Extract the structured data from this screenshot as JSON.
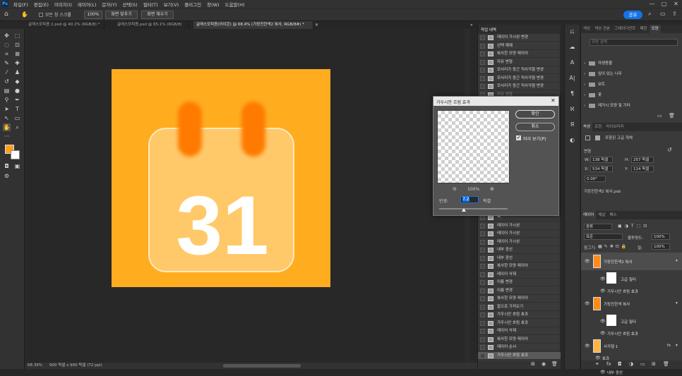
{
  "app": {
    "logo": "Ps"
  },
  "menu": [
    "파일(F)",
    "편집(E)",
    "이미지(I)",
    "레이어(L)",
    "문자(Y)",
    "선택(S)",
    "필터(T)",
    "보기(V)",
    "플러그인",
    "창(W)",
    "도움말(H)"
  ],
  "window_controls": {
    "minimize": "—",
    "maximize": "▢",
    "close": "✕"
  },
  "options": {
    "scroll_all": "모든 창 스크롤",
    "zoom": "100%",
    "fit_screen": "화면 맞추기",
    "fill_screen": "화면 채우기",
    "share": "공유"
  },
  "doc_tabs": [
    {
      "label": "글래스모피즘 2.psd @ 40.2% (RGB/8) *",
      "active": false
    },
    {
      "label": "글래스모피즘.psd @ 65.1% (RGB/8)",
      "active": false
    },
    {
      "label": "글래스모피즘(아이콘) @ 68.4% (가장진한색2 복사, RGB/8#) *",
      "active": true
    }
  ],
  "canvas": {
    "calendar_number": "31",
    "bg_color": "#ffad1f",
    "ring_color": "#ff7a00"
  },
  "status": {
    "zoom": "68.39%",
    "doc_info": "900 픽셀 x 900 픽셀 (72 ppi)"
  },
  "history": {
    "title": "작업 내역",
    "items_top": [
      "레이어 가시성 변경",
      "선택 해제",
      "복사한 모양 레이어",
      "자유 변형",
      "모서리가 둥근 직사각형 변경",
      "모서리가 둥근 직사각형 변경",
      "모서리가 둥근 직사각형 변경",
      "자유 변형"
    ],
    "items_bottom": [
      "픽",
      "레이어 가시성",
      "레이어 가시성",
      "레이어 가시성",
      "내부 광선",
      "내부 광선",
      "복사한 모양 레이어",
      "레이어 삭제",
      "이름 변경",
      "이름 변경",
      "복사한 모양 레이어",
      "알으로 가져오기",
      "가우시안 흐림 효과",
      "가우시안 흐림 효과",
      "레이어 삭제",
      "복사한 모양 레이어",
      "레이어 순서",
      "가우시안 흐림 효과"
    ]
  },
  "dialog": {
    "title": "가우시안 흐림 효과",
    "ok": "확인",
    "cancel": "취소",
    "preview": "미리 보기(P)",
    "zoom": "100%",
    "radius_label": "반경:",
    "radius_value": "7.2",
    "radius_unit": "픽셀",
    "radius_fraction": 0.36
  },
  "shapes_panel": {
    "tabs": [
      "색상",
      "색상 견본",
      "그레이디언트",
      "패턴",
      "모양"
    ],
    "search": "모양 검색",
    "items": [
      "야생동물",
      "잎이 있는 나무",
      "보트",
      "꽃",
      "레거시 모양 및 기타"
    ]
  },
  "properties": {
    "tabs": [
      "속성",
      "조정",
      "라이브러리"
    ],
    "type": "고급 개체",
    "kind": "포함된 고급 개체",
    "transform": "변형",
    "w": "W:",
    "w_val": "138 픽셀",
    "h": "H:",
    "h_val": "257 픽셀",
    "x": "X:",
    "x_val": "534 픽셀",
    "y": "Y:",
    "y_val": "114 픽셀",
    "angle": "0.00°",
    "file": "가장진한색2 복사.psb"
  },
  "layers": {
    "tabs": [
      "레이어",
      "채널",
      "패스"
    ],
    "filter": "종류",
    "blend": "표준",
    "opacity_label": "불투명도:",
    "opacity": "100%",
    "lock_label": "잠그기:",
    "fill_label": "칠:",
    "fill": "100%",
    "rows": [
      {
        "name": "가장진한색2 복사",
        "type": "smart",
        "fx": ""
      },
      {
        "name": "고급 필터",
        "type": "filter",
        "fx": ""
      },
      {
        "name": "가우시안 흐림 효과",
        "type": "effect",
        "fx": ""
      },
      {
        "name": "가장진한색 복사",
        "type": "smart",
        "fx": ""
      },
      {
        "name": "고급 필터",
        "type": "filter",
        "fx": ""
      },
      {
        "name": "가우시안 흐림 효과",
        "type": "effect",
        "fx": ""
      },
      {
        "name": "사각형 1",
        "type": "shape",
        "fx": "fx"
      },
      {
        "name": "효과",
        "type": "sub",
        "fx": ""
      },
      {
        "name": "획",
        "type": "sub2",
        "fx": ""
      },
      {
        "name": "내부 광선",
        "type": "sub2",
        "fx": ""
      }
    ]
  }
}
